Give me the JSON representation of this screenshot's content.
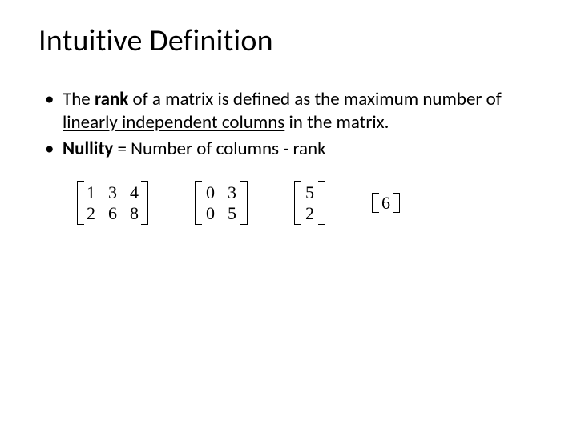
{
  "title": "Intuitive Definition",
  "bullets": {
    "b1_pre": "The ",
    "b1_rank": "rank",
    "b1_mid": " of a matrix is defined as the maximum number of ",
    "b1_licols": "linearly independent columns",
    "b1_post": " in the matrix.",
    "b2_nullity": "Nullity",
    "b2_rest": " = Number of columns - rank"
  },
  "matrices": {
    "m1": {
      "rows": 2,
      "cols": 3,
      "data": [
        [
          "1",
          "3",
          "4"
        ],
        [
          "2",
          "6",
          "8"
        ]
      ]
    },
    "m2": {
      "rows": 2,
      "cols": 2,
      "data": [
        [
          "0",
          "3"
        ],
        [
          "0",
          "5"
        ]
      ]
    },
    "m3": {
      "rows": 2,
      "cols": 1,
      "data": [
        [
          "5"
        ],
        [
          "2"
        ]
      ]
    },
    "m4": {
      "rows": 1,
      "cols": 1,
      "data": [
        [
          "6"
        ]
      ]
    }
  },
  "cells": {
    "m1_0_0": "1",
    "m1_0_1": "3",
    "m1_0_2": "4",
    "m1_1_0": "2",
    "m1_1_1": "6",
    "m1_1_2": "8",
    "m2_0_0": "0",
    "m2_0_1": "3",
    "m2_1_0": "0",
    "m2_1_1": "5",
    "m3_0_0": "5",
    "m3_1_0": "2",
    "m4_0_0": "6"
  }
}
